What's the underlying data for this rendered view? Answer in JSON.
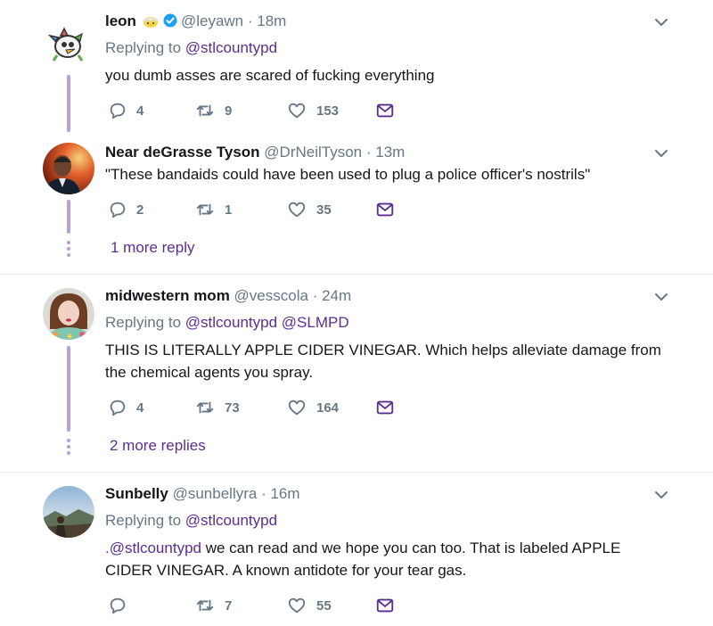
{
  "tweets": [
    {
      "name": "leon",
      "handle": "@leyawn",
      "time": "· 18m",
      "replying_prefix": "Replying to",
      "replying_to": "@stlcountypd",
      "body_lines": [
        "you dumb asses are scared of fucking everything"
      ],
      "replies": "4",
      "retweets": "9",
      "likes": "153",
      "avatar_icon": "cartoon-bird-avatar"
    },
    {
      "name": "Near deGrasse Tyson",
      "handle": "@DrNeilTyson",
      "time": "· 13m",
      "body_lines": [
        "\"These bandaids could have been used to plug a police officer's nostrils\""
      ],
      "replies": "2",
      "retweets": "1",
      "likes": "35",
      "more_replies": "1 more reply",
      "avatar_icon": "man-photo-avatar"
    },
    {
      "name": "midwestern mom",
      "handle": "@vesscola",
      "time": "· 24m",
      "replying_prefix": "Replying to",
      "replying_to": "@stlcountypd @SLMPD",
      "body_lines": [
        "THIS IS LITERALLY APPLE CIDER VINEGAR. Which helps alleviate damage from",
        "the chemical agents you spray."
      ],
      "replies": "4",
      "retweets": "73",
      "likes": "164",
      "more_replies": "2 more replies",
      "avatar_icon": "woman-photo-avatar"
    },
    {
      "name": "Sunbelly",
      "handle": "@sunbellyra",
      "time": "· 16m",
      "replying_prefix": "Replying to",
      "replying_to": "@stlcountypd",
      "body_mention": ".@stlcountypd",
      "body_line1_rest": " we can read and we hope you can too. That is labeled APPLE",
      "body_line2": "CIDER VINEGAR. A known antidote for your tear gas.",
      "replies": "",
      "retweets": "7",
      "likes": "55",
      "avatar_icon": "landscape-photo-avatar"
    }
  ],
  "colors": {
    "link": "#5c2d91",
    "muted": "#657786",
    "thread": "#b4a1d8",
    "verified": "#1da1f2"
  },
  "icons": [
    "reply-icon",
    "retweet-icon",
    "like-icon",
    "direct-message-icon",
    "chevron-down-icon",
    "verified-badge-icon",
    "chick-emoji-icon"
  ]
}
